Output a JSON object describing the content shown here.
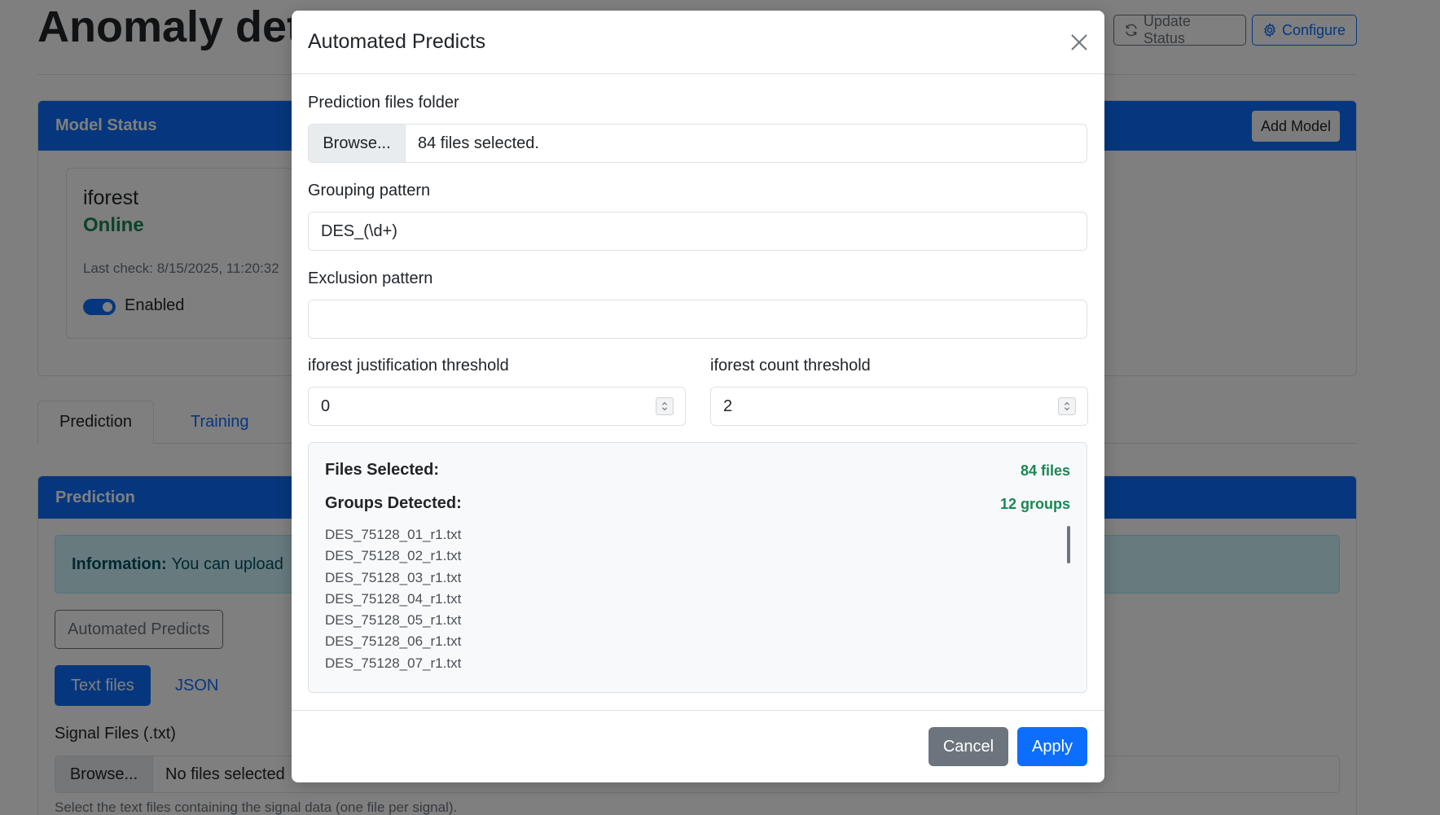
{
  "background": {
    "page_title": "Anomaly det",
    "update_status_label": "Update Status",
    "configure_label": "Configure",
    "model_status_header": "Model Status",
    "add_model_label": "Add Model",
    "model": {
      "name": "iforest",
      "status": "Online",
      "last_check": "Last check: 8/15/2025, 11:20:32",
      "enabled_label": "Enabled",
      "enabled": true
    },
    "tabs": [
      {
        "label": "Prediction",
        "active": true
      },
      {
        "label": "Training",
        "active": false
      }
    ],
    "prediction_header": "Prediction",
    "info_alert": {
      "bold": "Information:",
      "text": "You can upload"
    },
    "automated_predicts_label": "Automated Predicts",
    "input_mode_tabs": [
      "Text files",
      "JSON"
    ],
    "signal_files_label": "Signal Files (.txt)",
    "signal_browse_label": "Browse...",
    "signal_files_value": "No files selected",
    "signal_help": "Select the text files containing the signal data (one file per signal)."
  },
  "modal": {
    "title": "Automated Predicts",
    "folder_label": "Prediction files folder",
    "folder_browse_label": "Browse...",
    "folder_value": "84 files selected.",
    "grouping_label": "Grouping pattern",
    "grouping_value": "DES_(\\d+)",
    "exclusion_label": "Exclusion pattern",
    "exclusion_value": "",
    "justification_label": "iforest justification threshold",
    "justification_value": "0",
    "count_label": "iforest count threshold",
    "count_value": "2",
    "summary": {
      "files_selected_label": "Files Selected:",
      "files_selected_value": "84 files",
      "groups_detected_label": "Groups Detected:",
      "groups_detected_value": "12 groups",
      "files": [
        "DES_75128_01_r1.txt",
        "DES_75128_02_r1.txt",
        "DES_75128_03_r1.txt",
        "DES_75128_04_r1.txt",
        "DES_75128_05_r1.txt",
        "DES_75128_06_r1.txt",
        "DES_75128_07_r1.txt"
      ]
    },
    "cancel_label": "Cancel",
    "apply_label": "Apply"
  },
  "colors": {
    "primary": "#0d6efd",
    "success": "#198754",
    "secondary": "#6c757d",
    "info_bg": "#cff4fc"
  },
  "icons": {
    "update_status": "refresh-icon",
    "configure": "gear-icon",
    "close": "close-icon",
    "spinner": "spinner-arrows-icon"
  }
}
